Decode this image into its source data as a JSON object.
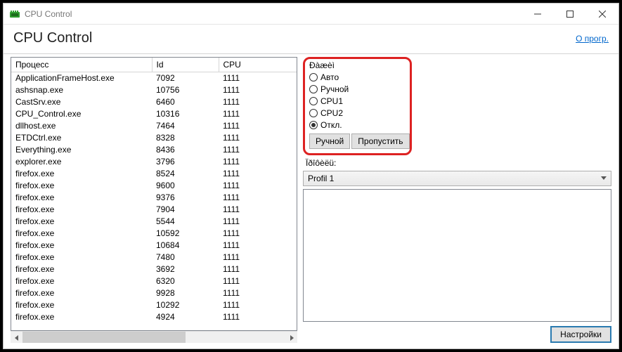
{
  "window": {
    "title": "CPU Control"
  },
  "header": {
    "title": "CPU Control",
    "about": "О прогр."
  },
  "table": {
    "columns": {
      "proc": "Процесс",
      "id": "Id",
      "cpu": "CPU"
    },
    "rows": [
      {
        "proc": "ApplicationFrameHost.exe",
        "id": "7092",
        "cpu": "1111"
      },
      {
        "proc": "ashsnap.exe",
        "id": "10756",
        "cpu": "1111"
      },
      {
        "proc": "CastSrv.exe",
        "id": "6460",
        "cpu": "1111"
      },
      {
        "proc": "CPU_Control.exe",
        "id": "10316",
        "cpu": "1111"
      },
      {
        "proc": "dllhost.exe",
        "id": "7464",
        "cpu": "1111"
      },
      {
        "proc": "ETDCtrl.exe",
        "id": "8328",
        "cpu": "1111"
      },
      {
        "proc": "Everything.exe",
        "id": "8436",
        "cpu": "1111"
      },
      {
        "proc": "explorer.exe",
        "id": "3796",
        "cpu": "1111"
      },
      {
        "proc": "firefox.exe",
        "id": "8524",
        "cpu": "1111"
      },
      {
        "proc": "firefox.exe",
        "id": "9600",
        "cpu": "1111"
      },
      {
        "proc": "firefox.exe",
        "id": "9376",
        "cpu": "1111"
      },
      {
        "proc": "firefox.exe",
        "id": "7904",
        "cpu": "1111"
      },
      {
        "proc": "firefox.exe",
        "id": "5544",
        "cpu": "1111"
      },
      {
        "proc": "firefox.exe",
        "id": "10592",
        "cpu": "1111"
      },
      {
        "proc": "firefox.exe",
        "id": "10684",
        "cpu": "1111"
      },
      {
        "proc": "firefox.exe",
        "id": "7480",
        "cpu": "1111"
      },
      {
        "proc": "firefox.exe",
        "id": "3692",
        "cpu": "1111"
      },
      {
        "proc": "firefox.exe",
        "id": "6320",
        "cpu": "1111"
      },
      {
        "proc": "firefox.exe",
        "id": "9928",
        "cpu": "1111"
      },
      {
        "proc": "firefox.exe",
        "id": "10292",
        "cpu": "1111"
      },
      {
        "proc": "firefox.exe",
        "id": "4924",
        "cpu": "1111"
      }
    ]
  },
  "mode": {
    "title": "Ðàæèì",
    "options": [
      {
        "label": "Авто",
        "selected": false
      },
      {
        "label": "Ручной",
        "selected": false
      },
      {
        "label": "CPU1",
        "selected": false
      },
      {
        "label": "CPU2",
        "selected": false
      },
      {
        "label": "Откл.",
        "selected": true
      }
    ],
    "manual_button": "Ручной",
    "skip_button": "Пропустить"
  },
  "profiles": {
    "label": "Ïðîôèëü:",
    "selected": "Profil 1"
  },
  "settings_button": "Настройки"
}
